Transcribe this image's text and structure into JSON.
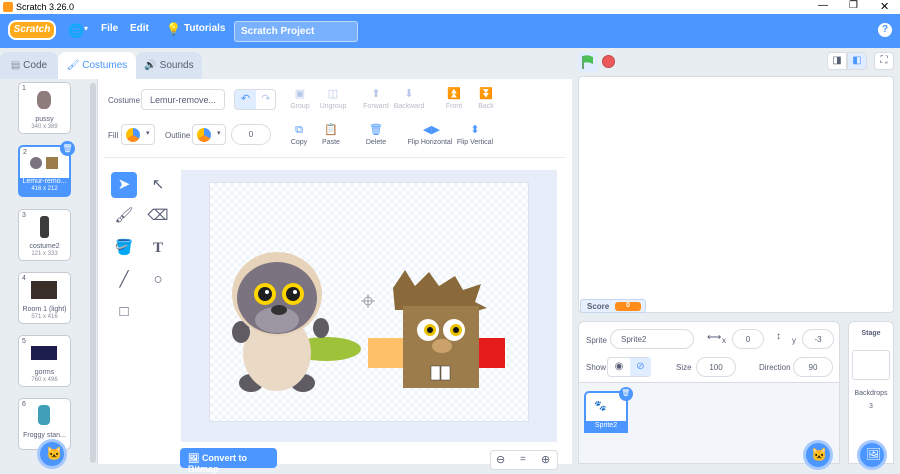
{
  "window": {
    "title": "Scratch 3.26.0"
  },
  "menu": {
    "logo": "Scratch",
    "file": "File",
    "edit": "Edit",
    "tutorials": "Tutorials",
    "project_title": "Scratch Project"
  },
  "tabs": {
    "code": "Code",
    "costumes": "Costumes",
    "sounds": "Sounds"
  },
  "costumes": [
    {
      "num": "1",
      "name": "pussy",
      "size": "340 x 389"
    },
    {
      "num": "2",
      "name": "Lemur-remo...",
      "size": "416 x 212"
    },
    {
      "num": "3",
      "name": "costume2",
      "size": "121 x 333"
    },
    {
      "num": "4",
      "name": "Room 1 (light)",
      "size": "571 x 416"
    },
    {
      "num": "5",
      "name": "gorms",
      "size": "760 x 496"
    },
    {
      "num": "6",
      "name": "Froggy stan...",
      "size": ""
    }
  ],
  "editor": {
    "costume_label": "Costume",
    "costume_name": "Lemur-remove...",
    "group": "Group",
    "ungroup": "Ungroup",
    "forward": "Forward",
    "backward": "Backward",
    "front": "Front",
    "back": "Back",
    "fill": "Fill",
    "outline": "Outline",
    "outline_width": "0",
    "copy": "Copy",
    "paste": "Paste",
    "delete": "Delete",
    "flip_h": "Flip Horizontal",
    "flip_v": "Flip Vertical",
    "convert": "Convert to Bitmap",
    "zoom_reset": "="
  },
  "stage": {
    "score_label": "Score",
    "score_value": "0"
  },
  "sprite_info": {
    "sprite_label": "Sprite",
    "sprite_name": "Sprite2",
    "x_label": "x",
    "x": "0",
    "y_label": "y",
    "y": "-3",
    "show_label": "Show",
    "size_label": "Size",
    "size": "100",
    "direction_label": "Direction",
    "direction": "90"
  },
  "sprites": [
    {
      "name": "Sprite2"
    }
  ],
  "stage_panel": {
    "title": "Stage",
    "backdrops_label": "Backdrops",
    "backdrops_count": "3"
  },
  "colors": {
    "accent": "#4c97ff",
    "score": "#ff8c1a",
    "green_flag": "#4cbf56",
    "stop": "#ec5959",
    "delete": "#4c97ff"
  }
}
